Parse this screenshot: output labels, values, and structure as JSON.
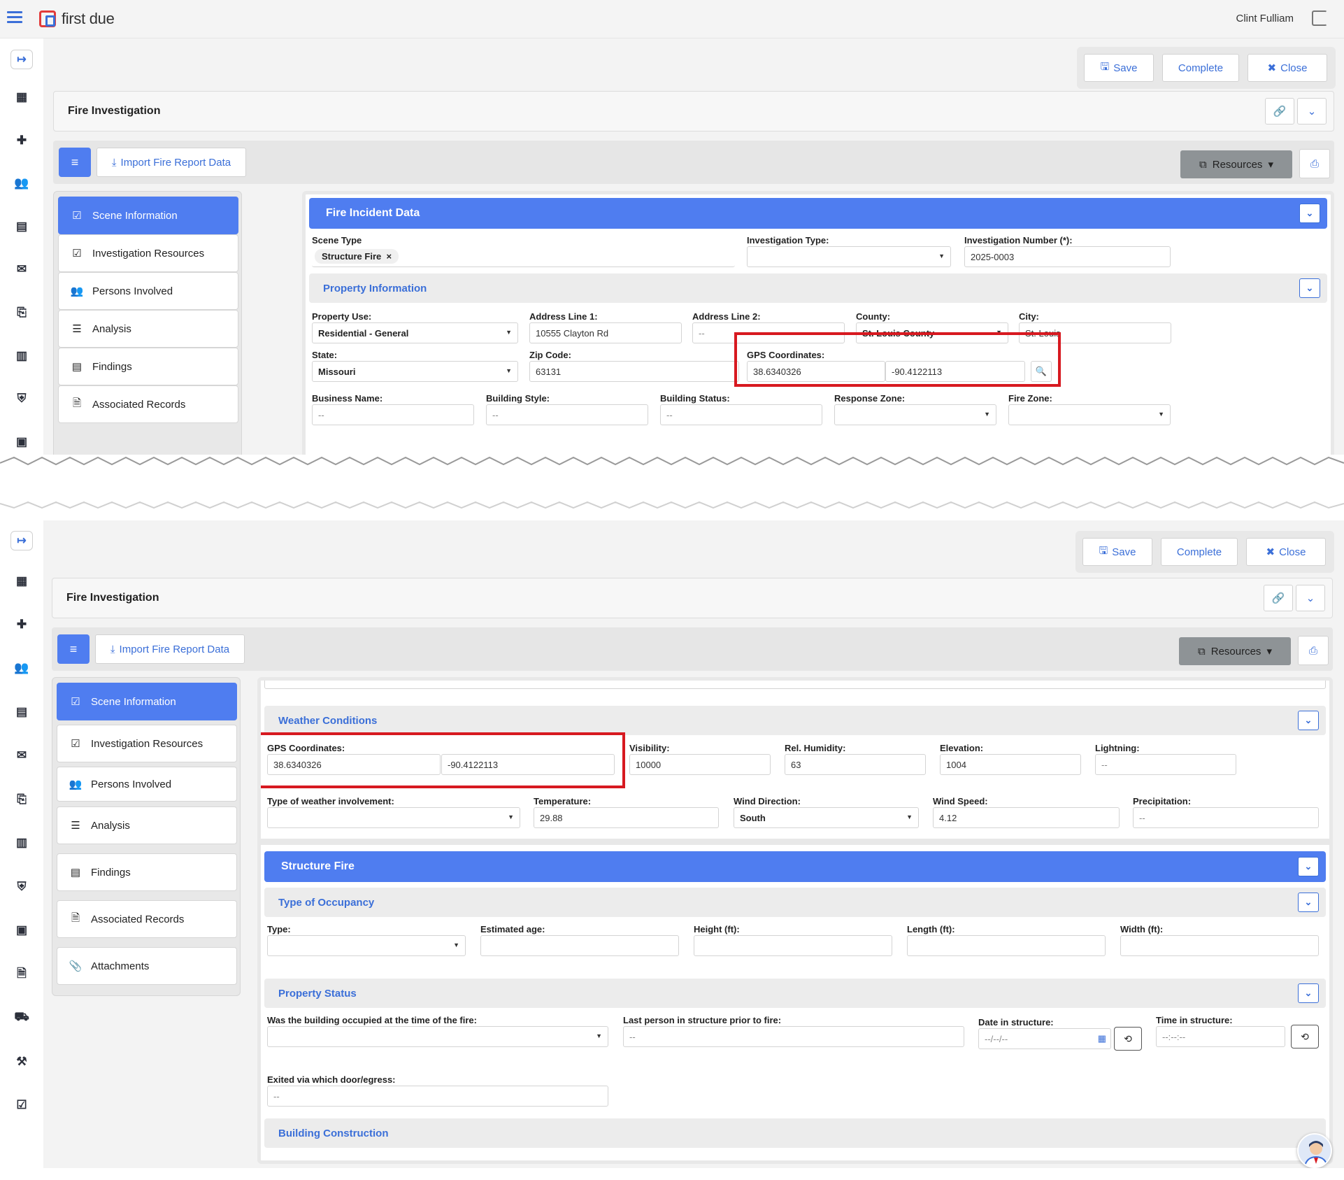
{
  "app": {
    "brand": "first due",
    "user": "Clint Fulliam"
  },
  "toolbar": {
    "save": "Save",
    "complete": "Complete",
    "close": "Close"
  },
  "page": {
    "title": "Fire Investigation"
  },
  "actions": {
    "import": "Import Fire Report Data",
    "resources": "Resources"
  },
  "nav": {
    "items": [
      "Scene Information",
      "Investigation Resources",
      "Persons Involved",
      "Analysis",
      "Findings",
      "Associated Records",
      "Attachments"
    ],
    "active": "Scene Information"
  },
  "top_form": {
    "section": "Fire Incident Data",
    "scene_type_label": "Scene Type",
    "scene_type_tag": "Structure Fire",
    "investigation_type_label": "Investigation Type:",
    "investigation_number_label": "Investigation Number (*):",
    "investigation_number": "2025-0003",
    "property_info": "Property Information",
    "property_use_label": "Property Use:",
    "property_use": "Residential - General",
    "address1_label": "Address Line 1:",
    "address1": "10555 Clayton Rd",
    "address2_label": "Address Line 2:",
    "address2": "--",
    "county_label": "County:",
    "county": "St. Louis County",
    "city_label": "City:",
    "city": "St. Louis",
    "state_label": "State:",
    "state": "Missouri",
    "zip_label": "Zip Code:",
    "zip": "63131",
    "gps_label": "GPS Coordinates:",
    "gps_lat": "38.6340326",
    "gps_lon": "-90.4122113",
    "business_label": "Business Name:",
    "business": "--",
    "style_label": "Building Style:",
    "style": "--",
    "status_label": "Building Status:",
    "status": "--",
    "response_zone_label": "Response Zone:",
    "fire_zone_label": "Fire Zone:"
  },
  "bottom_form": {
    "weather": "Weather Conditions",
    "gps_label": "GPS Coordinates:",
    "gps_lat": "38.6340326",
    "gps_lon": "-90.4122113",
    "visibility_label": "Visibility:",
    "visibility": "10000",
    "humidity_label": "Rel. Humidity:",
    "humidity": "63",
    "elevation_label": "Elevation:",
    "elevation": "1004",
    "lightning_label": "Lightning:",
    "lightning": "--",
    "weather_involvement_label": "Type of weather involvement:",
    "temperature_label": "Temperature:",
    "temperature": "29.88",
    "wind_direction_label": "Wind Direction:",
    "wind_direction": "South",
    "wind_speed_label": "Wind Speed:",
    "wind_speed": "4.12",
    "precipitation_label": "Precipitation:",
    "precipitation": "--",
    "structure_fire": "Structure Fire",
    "occupancy": "Type of Occupancy",
    "type_label": "Type:",
    "est_age_label": "Estimated age:",
    "height_label": "Height (ft):",
    "length_label": "Length (ft):",
    "width_label": "Width (ft):",
    "property_status": "Property Status",
    "occupied_label": "Was the building occupied at the time of the fire:",
    "last_person_label": "Last person in structure prior to fire:",
    "last_person": "--",
    "date_label": "Date in structure:",
    "date_ph": "--/--/--",
    "time_label": "Time in structure:",
    "time_ph": "--:--:--",
    "exited_label": "Exited via which door/egress:",
    "exited": "--",
    "building_construction": "Building Construction"
  },
  "colors": {
    "accent": "#4f7df0",
    "highlight": "#d71920",
    "resources": "#8e9396"
  }
}
